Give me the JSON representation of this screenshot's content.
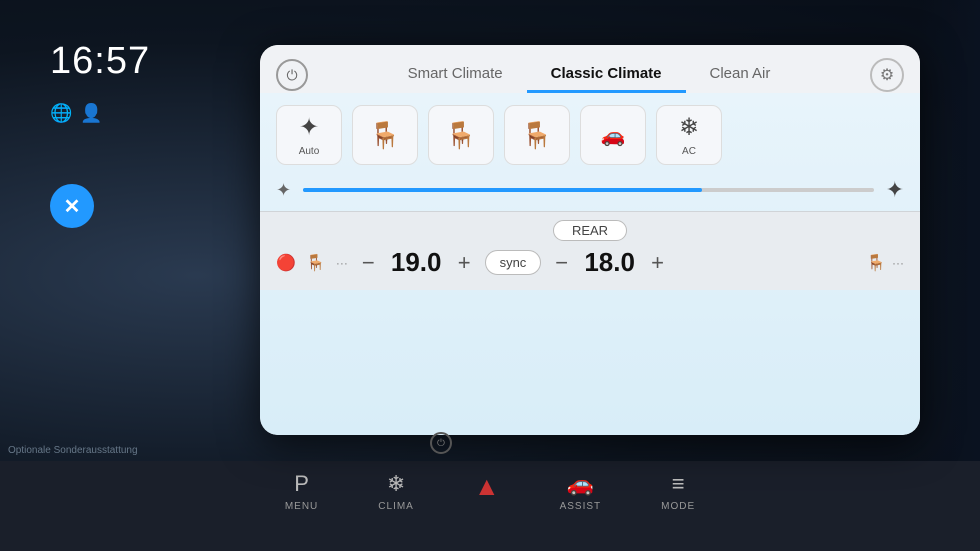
{
  "ui": {
    "time": "16:57",
    "caption": "Optionale Sonderausstattung",
    "tabs": [
      {
        "id": "smart-climate",
        "label": "Smart Climate",
        "active": false
      },
      {
        "id": "classic-climate",
        "label": "Classic Climate",
        "active": true
      },
      {
        "id": "clean-air",
        "label": "Clean Air",
        "active": false
      }
    ],
    "icons": {
      "power": "⏻",
      "settings": "⚙",
      "close": "✕",
      "globe": "🌐",
      "person": "👤",
      "fan": "✦",
      "seat_heat": "🔥"
    },
    "function_buttons": [
      {
        "id": "fan-auto",
        "symbol": "❊",
        "label": "Auto",
        "active": false
      },
      {
        "id": "seat-heat-1",
        "symbol": "🪑",
        "label": "",
        "active": false
      },
      {
        "id": "seat-heat-2",
        "symbol": "🪑",
        "label": "",
        "active": false
      },
      {
        "id": "seat-cool",
        "symbol": "🪑",
        "label": "",
        "active": false
      },
      {
        "id": "rear-window",
        "symbol": "⬜",
        "label": "",
        "active": false
      },
      {
        "id": "ac",
        "symbol": "❄",
        "label": "AC",
        "active": false
      }
    ],
    "fan_speed_percent": 70,
    "rear_label": "REAR",
    "left_zone": {
      "temp": "19.0",
      "seat_heat_dots": 3
    },
    "right_zone": {
      "temp": "18.0",
      "seat_heat_dots": 0
    },
    "sync_label": "sync",
    "hardware_buttons": [
      {
        "id": "menu",
        "symbol": "P",
        "label": "MENU"
      },
      {
        "id": "clima",
        "symbol": "❄",
        "label": "CLIMA"
      },
      {
        "id": "hazard",
        "symbol": "▲",
        "label": ""
      },
      {
        "id": "assist",
        "symbol": "🚗",
        "label": "ASSIST"
      },
      {
        "id": "mode",
        "symbol": "≡",
        "label": "MODE"
      }
    ],
    "colors": {
      "accent": "#2299ff",
      "active_tab_underline": "#2299ff",
      "seat_heat_active": "#cc3333",
      "screen_bg_top": "#e8f4fb",
      "screen_bg_bottom": "#d8edf8"
    }
  }
}
